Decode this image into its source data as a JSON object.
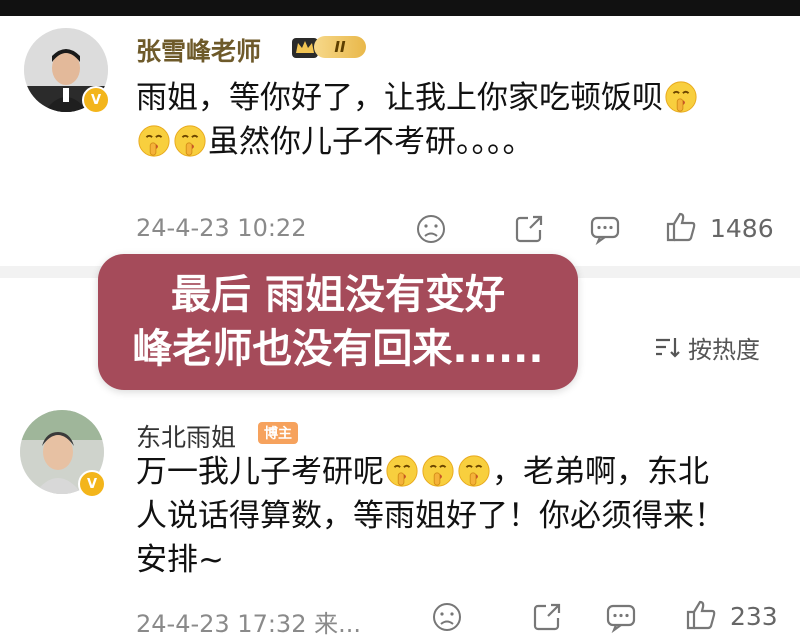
{
  "comments": [
    {
      "username": "张雪峰老师",
      "rank_label": "II",
      "line1": "雨姐，等你好了，让我上你家吃顿饭呗",
      "line2": "虽然你儿子不考研。。。。",
      "timestamp": "24-4-23 10:22",
      "likes": "1486"
    },
    {
      "username": "东北雨姐",
      "tag": "博主",
      "line1": "万一我儿子考研呢",
      "line1_tail": "，老弟啊，东北",
      "line2": "人说话得算数，等雨姐好了！你必须得来！",
      "line3": "安排~",
      "timestamp": "24-4-23 17:32 来...",
      "likes": "233"
    }
  ],
  "sort": {
    "label": "按热度"
  },
  "overlay": {
    "line1": "最后 雨姐没有变好",
    "line2": "峰老师也没有回来......"
  },
  "icons": {
    "emoji": "shushing-face-emoji",
    "dislike": "sad-face-icon",
    "share": "share-icon",
    "comment": "comment-icon",
    "like": "thumbs-up-icon",
    "sort": "sort-icon"
  },
  "colors": {
    "username": "#6e5a2a",
    "overlay_bg": "#a54b5a",
    "verified": "#f3b51b",
    "tag": "#f6a25d"
  }
}
